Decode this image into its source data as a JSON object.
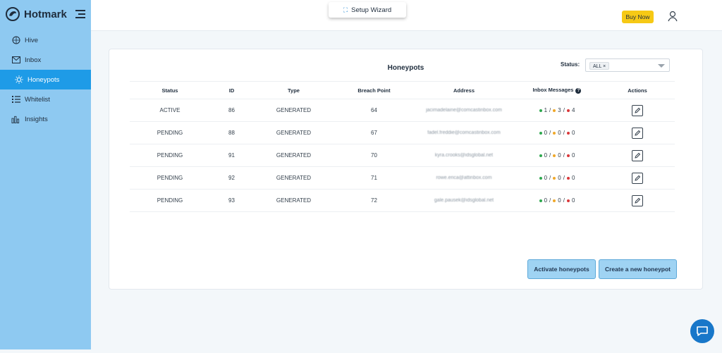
{
  "brand": {
    "name": "Hotmark"
  },
  "sidebar": {
    "items": [
      {
        "label": "Hive",
        "icon": "hive-icon"
      },
      {
        "label": "Inbox",
        "icon": "envelope-icon"
      },
      {
        "label": "Honeypots",
        "icon": "honeypot-icon",
        "active": true
      },
      {
        "label": "Whitelist",
        "icon": "list-icon"
      },
      {
        "label": "Insights",
        "icon": "chart-icon"
      }
    ]
  },
  "topbar": {
    "wizard_label": "Setup Wizard",
    "buy_label": "Buy Now"
  },
  "card": {
    "title": "Honeypots",
    "status_label": "Status:",
    "status_chip": "ALL ×"
  },
  "table": {
    "headers": [
      "Status",
      "ID",
      "Type",
      "Breach Point",
      "Address",
      "Inbox Messages",
      "Actions"
    ],
    "rows": [
      {
        "status": "ACTIVE",
        "id": "86",
        "type": "GENERATED",
        "breach": "64",
        "address": "jacimadelaine@comcastinbox.com",
        "g": "1",
        "y": "3",
        "r": "4"
      },
      {
        "status": "PENDING",
        "id": "88",
        "type": "GENERATED",
        "breach": "67",
        "address": "fadel.freddie@comcastinbox.com",
        "g": "0",
        "y": "0",
        "r": "0"
      },
      {
        "status": "PENDING",
        "id": "91",
        "type": "GENERATED",
        "breach": "70",
        "address": "kyra.crooks@idsglobal.net",
        "g": "0",
        "y": "0",
        "r": "0"
      },
      {
        "status": "PENDING",
        "id": "92",
        "type": "GENERATED",
        "breach": "71",
        "address": "rowe.erica@attinbox.com",
        "g": "0",
        "y": "0",
        "r": "0"
      },
      {
        "status": "PENDING",
        "id": "93",
        "type": "GENERATED",
        "breach": "72",
        "address": "gale.pausek@idsglobal.net",
        "g": "0",
        "y": "0",
        "r": "0"
      }
    ]
  },
  "buttons": {
    "activate": "Activate honeypots",
    "create": "Create a new honeypot"
  },
  "colors": {
    "sidebar": "#8ec9f1",
    "active": "#1e9be7",
    "buy": "#f6c915",
    "button": "#9fd3f3",
    "chat": "#1877c9"
  }
}
